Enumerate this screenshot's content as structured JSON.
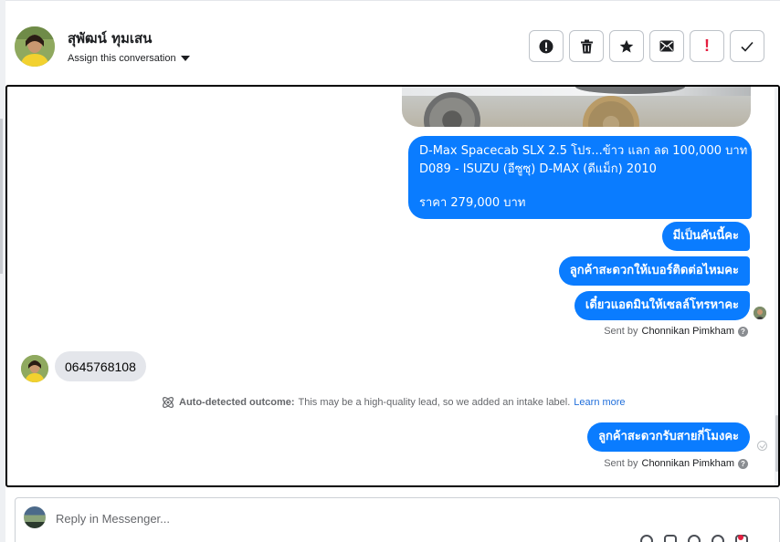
{
  "contact": {
    "name": "สุพัฒน์ ทุมเสน",
    "assign_label": "Assign this conversation"
  },
  "header_actions": [
    {
      "name": "spam-button",
      "icon": "exclamation-circle-icon"
    },
    {
      "name": "delete-button",
      "icon": "trash-icon"
    },
    {
      "name": "star-button",
      "icon": "star-icon"
    },
    {
      "name": "mark-unread-button",
      "icon": "envelope-icon"
    },
    {
      "name": "follow-up-button",
      "icon": "red-exclamation-icon",
      "glyph": "!"
    },
    {
      "name": "mark-done-button",
      "icon": "check-icon"
    }
  ],
  "messages": {
    "listing": {
      "line1": "D-Max Spacecab SLX 2.5 โปร...ข้าว แลก ลด 100,000 บาท",
      "line2": "D089 - ISUZU (อีซูซุ) D-MAX (ดีแม็ก) 2010",
      "price": "ราคา 279,000 บาท"
    },
    "out1": "มีเป็นคันนี้คะ",
    "out2": "ลูกค้าสะดวกให้เบอร์ติดต่อไหมคะ",
    "out3": "เดี๋ยวแอดมินให้เซลล์โทรหาคะ",
    "sent_by_label": "Sent by",
    "sent_by_name": "Chonnikan Pimkham",
    "incoming": "0645768108",
    "outcome_bold": "Auto-detected outcome:",
    "outcome_text": "This may be a high-quality lead, so we added an intake label.",
    "outcome_link": "Learn more",
    "out4": "ลูกค้าสะดวกรับสายกี่โมงคะ",
    "sent_by_label_2": "Sent by",
    "sent_by_name_2": "Chonnikan Pimkham"
  },
  "reply": {
    "placeholder": "Reply in Messenger..."
  },
  "colors": {
    "outgoing_bubble": "#0a7cff",
    "incoming_bubble": "#e4e6eb",
    "link": "#216fdb",
    "alert_red": "#e41e3f"
  }
}
